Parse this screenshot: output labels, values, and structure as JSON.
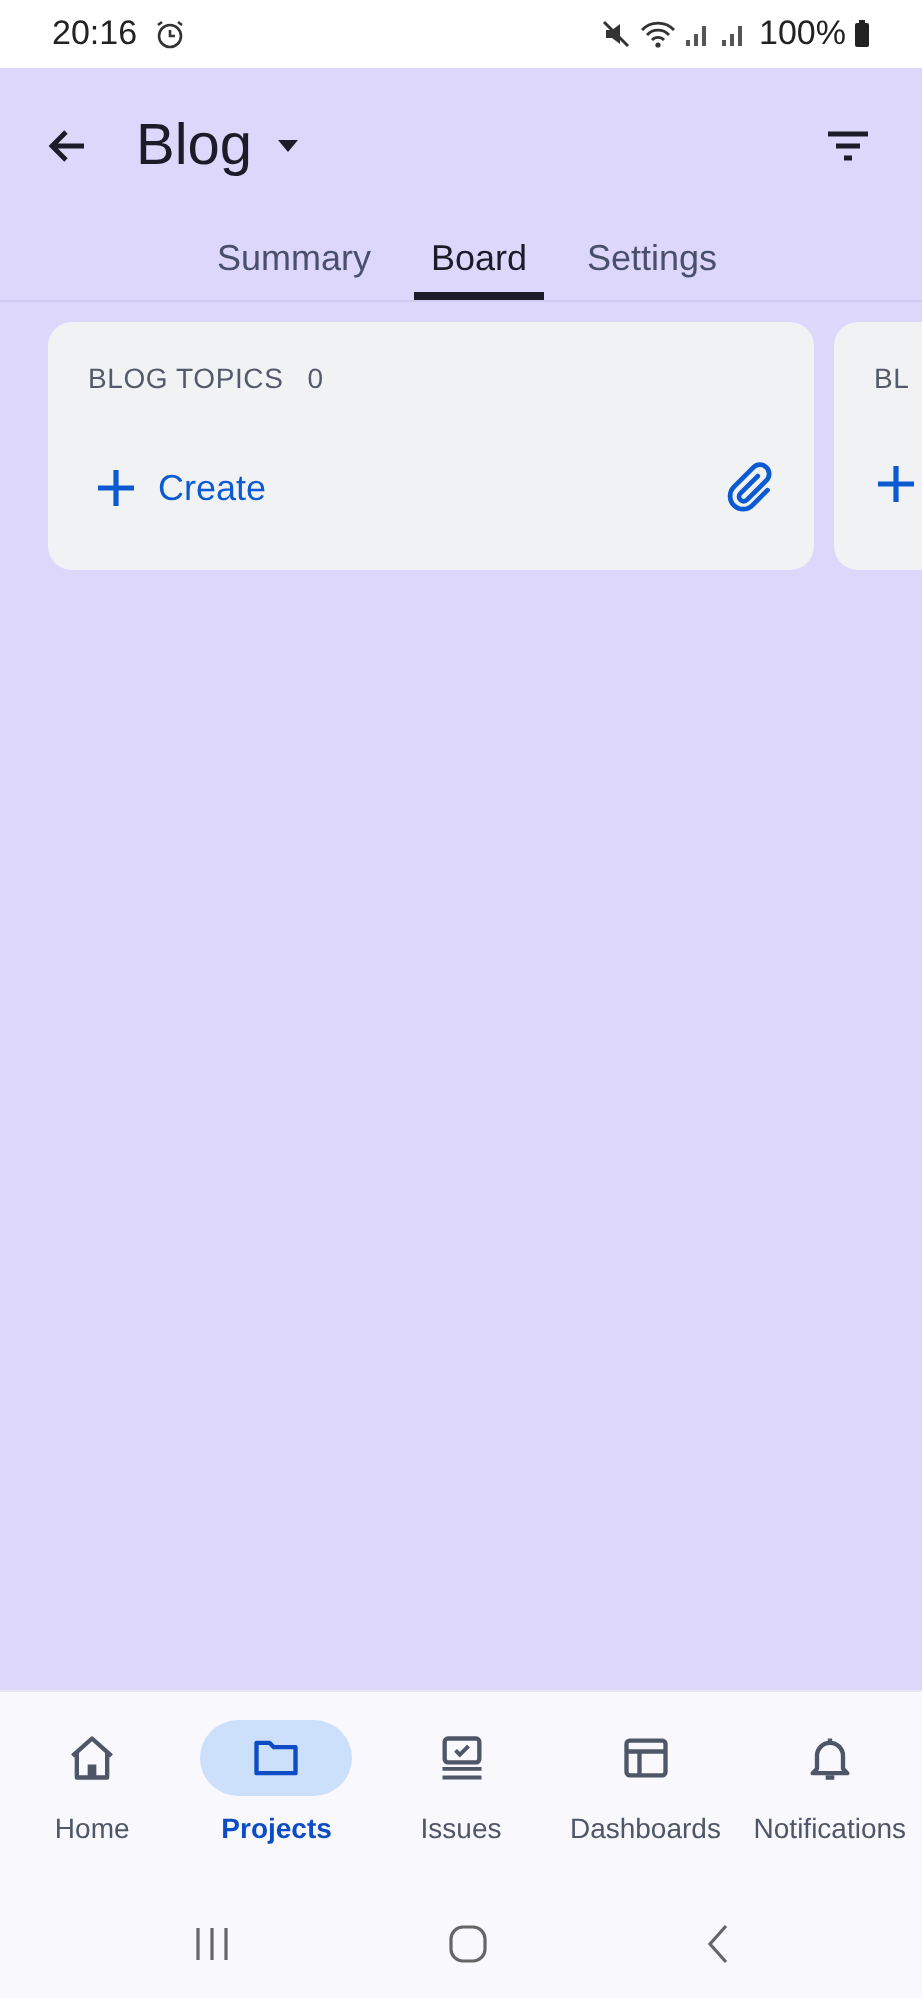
{
  "status_bar": {
    "time": "20:16",
    "battery": "100%"
  },
  "header": {
    "title": "Blog"
  },
  "tabs": [
    {
      "label": "Summary",
      "selected": false
    },
    {
      "label": "Board",
      "selected": true
    },
    {
      "label": "Settings",
      "selected": false
    }
  ],
  "columns": [
    {
      "title": "BLOG TOPICS",
      "count": "0",
      "create_label": "Create",
      "kind": "full"
    },
    {
      "title": "BL",
      "kind": "partial"
    }
  ],
  "bottom_nav": [
    {
      "label": "Home",
      "selected": false
    },
    {
      "label": "Projects",
      "selected": true
    },
    {
      "label": "Issues",
      "selected": false
    },
    {
      "label": "Dashboards",
      "selected": false
    },
    {
      "label": "Notifications",
      "selected": false
    }
  ]
}
